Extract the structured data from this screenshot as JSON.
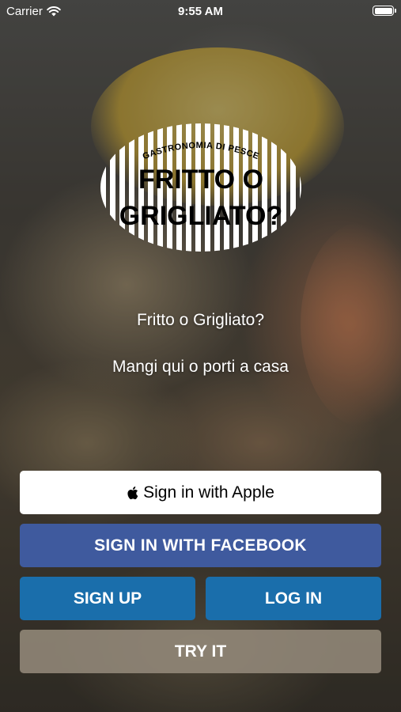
{
  "status_bar": {
    "carrier": "Carrier",
    "time": "9:55 AM"
  },
  "logo": {
    "arc_text": "GASTRONOMIA DI PESCE",
    "line1": "FRITTO O",
    "line2": "GRIGLIATO?"
  },
  "tagline": {
    "line1": "Fritto o Grigliato?",
    "line2": "Mangi qui o porti a casa"
  },
  "buttons": {
    "apple": "Sign in with Apple",
    "facebook": "SIGN IN WITH FACEBOOK",
    "signup": "SIGN UP",
    "login": "LOG IN",
    "try": "TRY IT"
  },
  "colors": {
    "facebook": "#3f5a9e",
    "primary": "#1a6eab",
    "try": "#968c7d"
  }
}
